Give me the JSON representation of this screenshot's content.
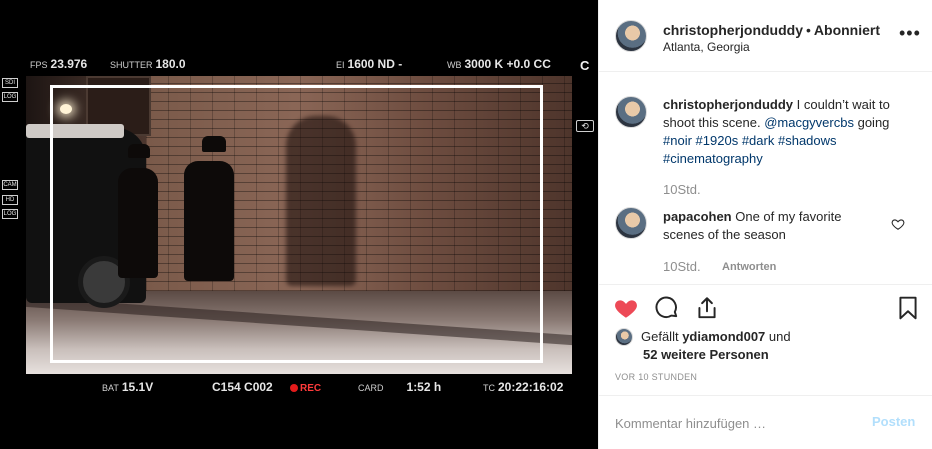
{
  "media": {
    "hud_top": [
      {
        "key": "FPS",
        "value": "23.976"
      },
      {
        "key": "SHUTTER",
        "value": "180.0"
      },
      {
        "key": "EI",
        "value": "1600 ND -"
      },
      {
        "key": "WB",
        "value": "3000 K  +0.0 CC"
      }
    ],
    "hud_corner": "C",
    "hud_bottom": [
      {
        "key": "BAT",
        "value": "15.1V"
      },
      {
        "key": "",
        "value": "C154 C002"
      },
      {
        "key": "",
        "value": "REC"
      },
      {
        "key": "CARD",
        "value": "1:52 h"
      },
      {
        "key": "TC",
        "value": "20:22:16:02"
      }
    ],
    "side_tags": [
      "SDI",
      "LOG",
      "CAM",
      "HD",
      "LOG"
    ]
  },
  "header": {
    "username": "christopherjonduddy",
    "separator": "•",
    "follow_label": "Abonniert",
    "location": "Atlanta, Georgia",
    "more_label": "•••"
  },
  "caption": {
    "username": "christopherjonduddy",
    "text": "I couldn’t wait to shoot this scene.",
    "mention": "@macgyvercbs",
    "text2": "going",
    "tags": [
      "#noir",
      "#1920s",
      "#dark",
      "#shadows",
      "#cinematography"
    ],
    "time": "10Std."
  },
  "comments": [
    {
      "username": "papacohen",
      "text": "One of my favorite scenes of the season",
      "time": "10Std.",
      "reply_label": "Antworten"
    }
  ],
  "likes": {
    "prefix": "Gefällt",
    "first_user": "ydiamond007",
    "and": "und",
    "others": "52 weitere Personen"
  },
  "timestamp": "VOR 10 STUNDEN",
  "add_comment": {
    "placeholder": "Kommentar hinzufügen …",
    "post_label": "Posten"
  },
  "colors": {
    "like_red": "#ed4956",
    "link_blue": "#00376b",
    "post_disabled": "#b2dffc",
    "muted": "#8e8e8e"
  }
}
